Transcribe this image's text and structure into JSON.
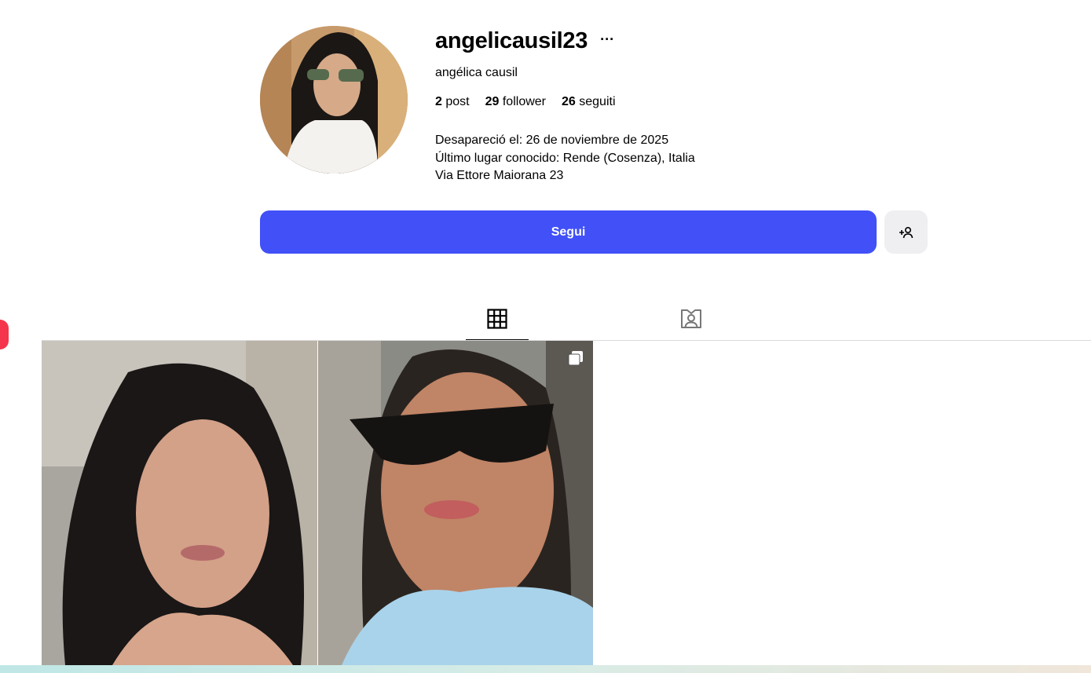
{
  "profile": {
    "username": "angelicausil23",
    "more_label": "···",
    "full_name": "angélica causil",
    "stats": {
      "posts_count": "2",
      "posts_label": "post",
      "followers_count": "29",
      "followers_label": "follower",
      "following_count": "26",
      "following_label": "seguiti"
    },
    "bio": [
      "Desapareció el: 26 de noviembre de 2025",
      "Último lugar conocido: Rende (Cosenza), Italia",
      "Via Ettore Maiorana 23"
    ]
  },
  "actions": {
    "follow_label": "Segui"
  },
  "tabs": [
    {
      "icon": "grid-icon",
      "active": true
    },
    {
      "icon": "tagged-icon",
      "active": false
    }
  ],
  "posts": [
    {
      "type": "photo"
    },
    {
      "type": "carousel",
      "icon": "multiple-images-icon"
    }
  ],
  "colors": {
    "accent": "#4150f7",
    "secondary_button": "#efeff2",
    "notification": "#f4354b"
  }
}
